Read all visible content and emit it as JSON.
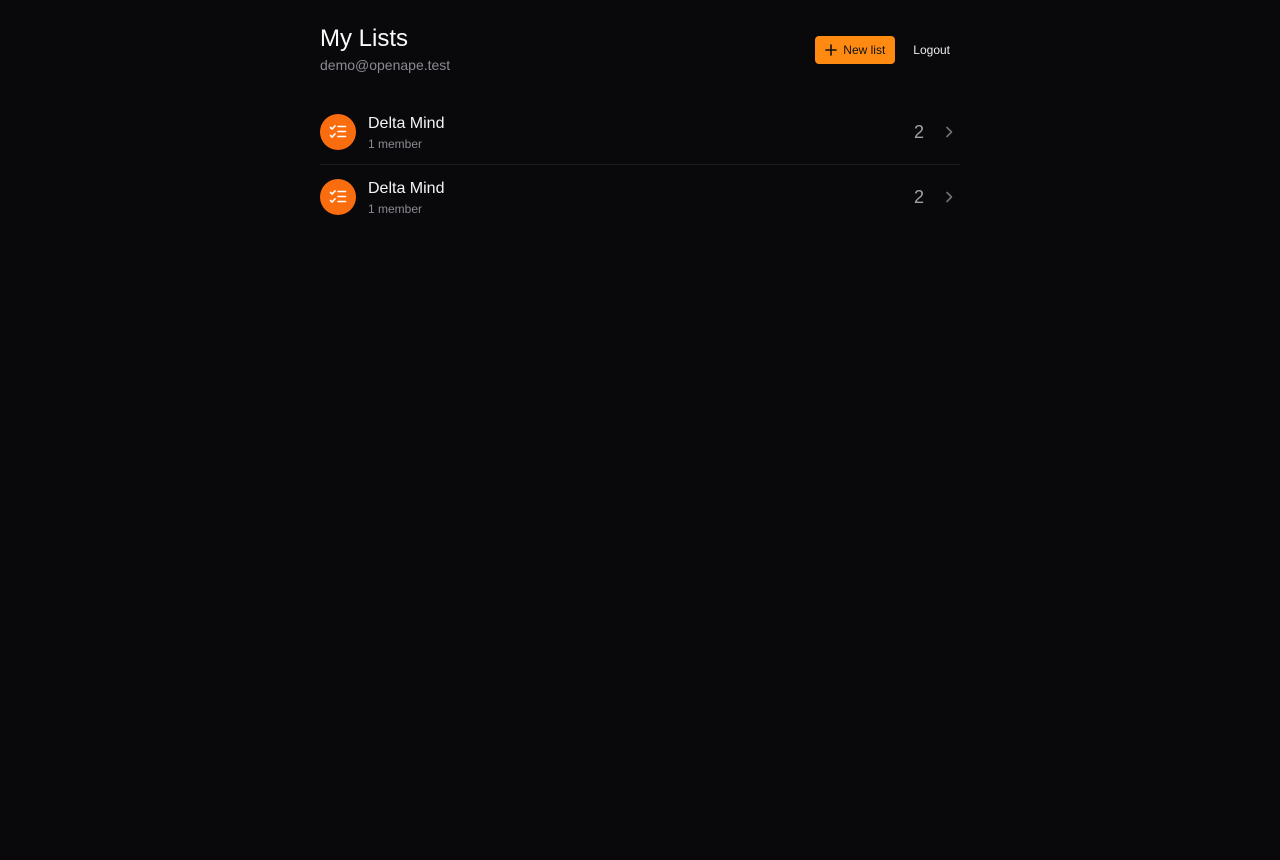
{
  "header": {
    "title": "My Lists",
    "email": "demo@openape.test",
    "new_list_label": "New list",
    "logout_label": "Logout"
  },
  "colors": {
    "accent": "#fe8a12",
    "list_icon_bg": "#f96d0f",
    "background": "#09090b"
  },
  "lists": [
    {
      "name": "Delta Mind",
      "members": "1 member",
      "count": "2",
      "icon": "checklist-icon"
    },
    {
      "name": "Delta Mind",
      "members": "1 member",
      "count": "2",
      "icon": "checklist-icon"
    }
  ]
}
